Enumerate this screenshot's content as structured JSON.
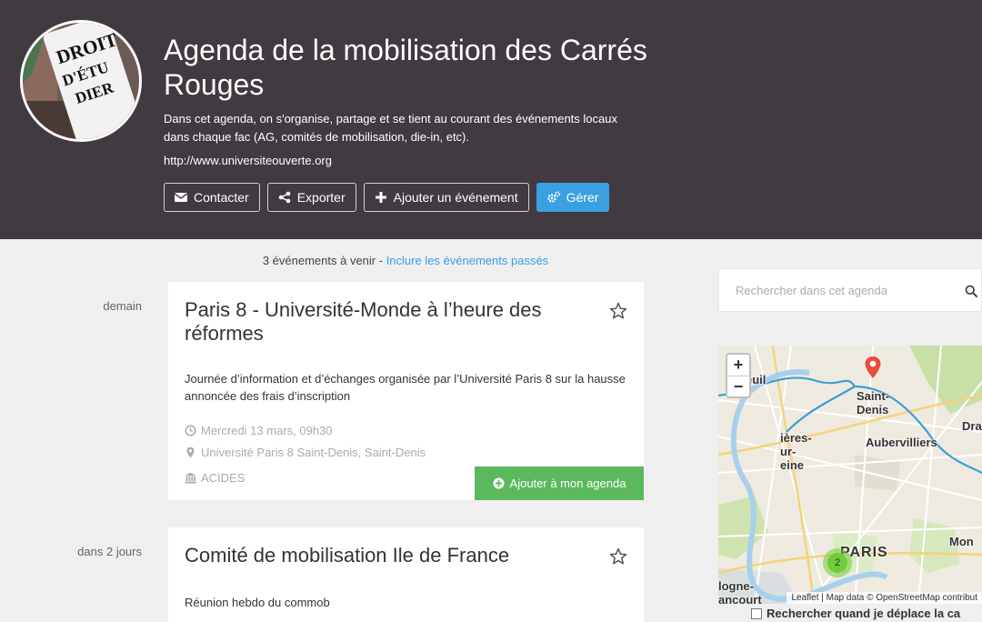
{
  "header": {
    "title": "Agenda de la mobilisation des Carrés Rouges",
    "description": "Dans cet agenda, on s'organise, partage et se tient au courant des événements locaux dans chaque fac (AG, comités de mobilisation, die-in, etc).",
    "url": "http://www.universiteouverte.org",
    "avatar_text": "DROIT D'ÉTUDIER",
    "buttons": {
      "contact": "Contacter",
      "export": "Exporter",
      "add_event": "Ajouter un événement",
      "manage": "Gérer"
    }
  },
  "listing": {
    "count_text": "3 événements à venir - ",
    "include_past_link": "Inclure les événements passés"
  },
  "events": [
    {
      "relative_date": "demain",
      "title": "Paris 8 - Université-Monde à l’heure des réformes",
      "description": "Journée d’information et d’échanges organisée par l’Université Paris 8 sur la hausse annoncée des frais d’inscription",
      "datetime": "Mercredi 13 mars, 09h30",
      "location": "Université Paris 8 Saint-Denis, Saint-Denis",
      "organizer": "ACIDES",
      "add_button": "Ajouter à mon agenda"
    },
    {
      "relative_date": "dans 2 jours",
      "title": "Comité de mobilisation Ile de France",
      "description": "Réunion hebdo du commob"
    }
  ],
  "sidebar": {
    "search_placeholder": "Rechercher dans cet agenda",
    "map": {
      "labels": {
        "epinay": "euil",
        "saint_denis": "Saint-\nDenis",
        "drancy": "Dra",
        "asnieres": "ières-\nur-\neine",
        "aubervilliers": "Aubervilliers",
        "paris": "PARIS",
        "montreuil": "Mon",
        "boulogne": "logne-\nancourt"
      },
      "zoom_in": "+",
      "zoom_out": "−",
      "cluster_count": "2",
      "attribution": "Leaflet | Map data © OpenStreetMap contribut"
    },
    "map_checkbox_label": "Rechercher quand je déplace la ca"
  },
  "icons": {
    "contact": "envelope-icon",
    "export": "share-icon",
    "add": "plus-icon",
    "manage": "gears-icon",
    "star": "star-outline-icon",
    "clock": "clock-icon",
    "location": "map-marker-icon",
    "organizer": "institution-icon",
    "add_agenda": "plus-circle-icon",
    "search": "search-icon"
  },
  "colors": {
    "header_bg": "#413a40",
    "primary": "#3aa0e0",
    "success": "#5cb85c",
    "cluster": "#6ecc39",
    "marker": "#e84c3d"
  }
}
